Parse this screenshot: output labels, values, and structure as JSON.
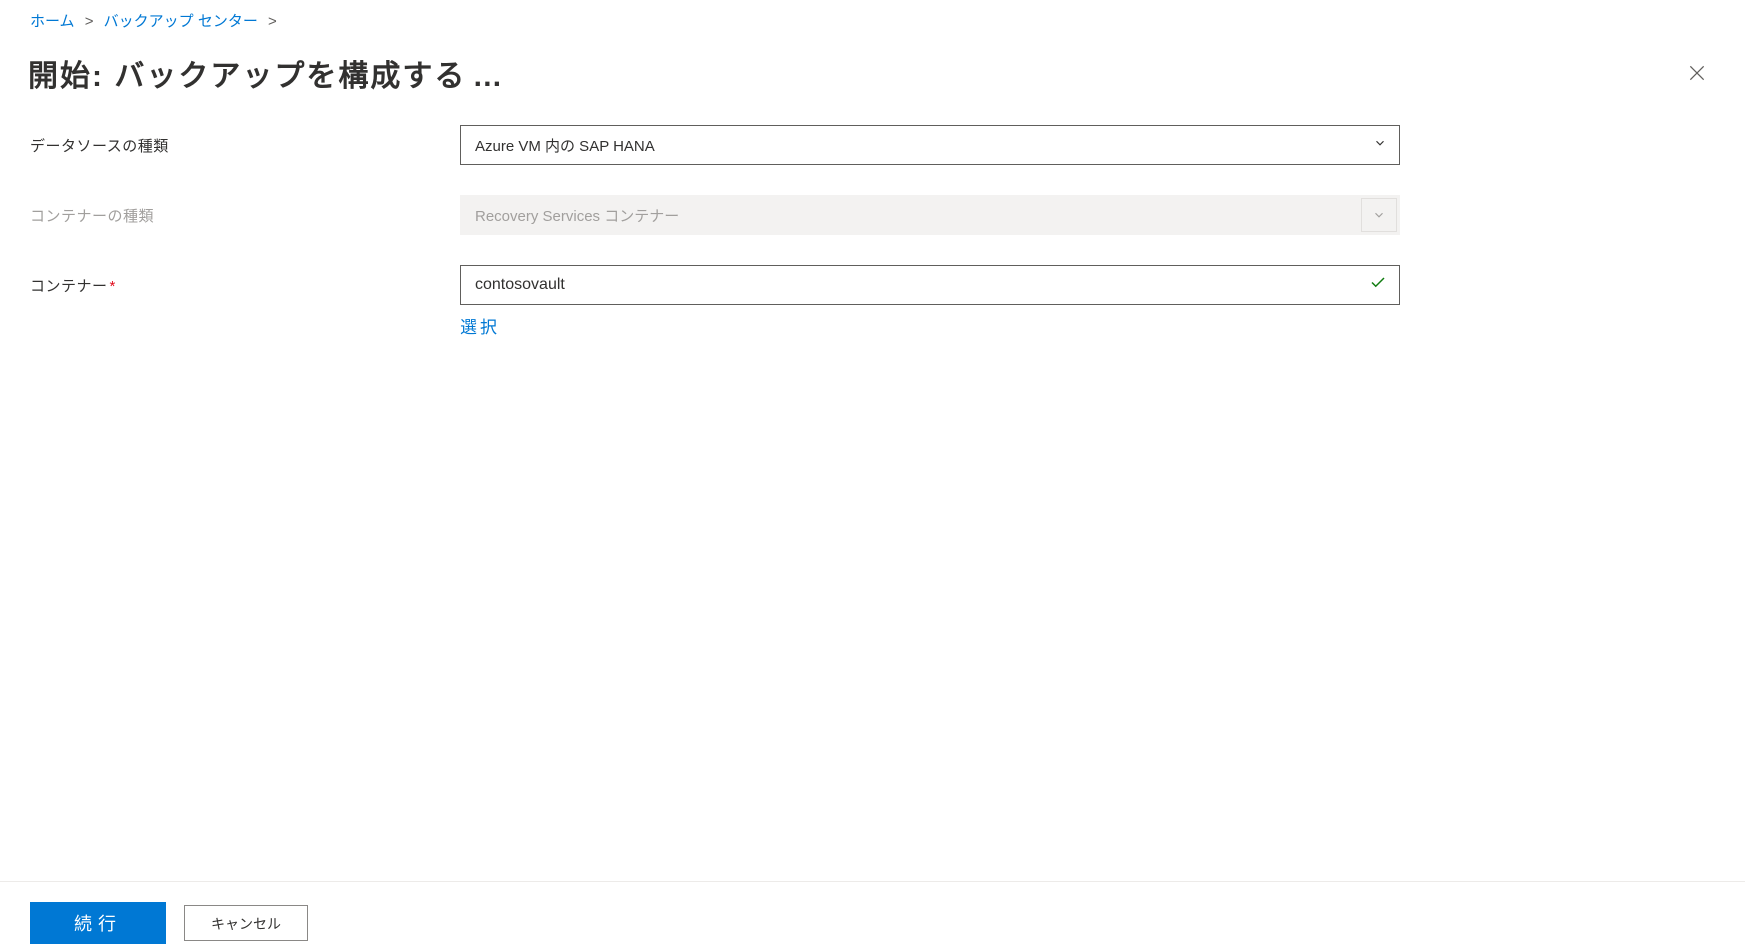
{
  "breadcrumb": {
    "home": "ホーム",
    "backup_center": "バックアップ センター"
  },
  "page_title": "開始: バックアップを構成する",
  "form": {
    "datasource_type": {
      "label": "データソースの種類",
      "value": "Azure VM 内の SAP HANA"
    },
    "container_type": {
      "label": "コンテナーの種類",
      "value": "Recovery Services コンテナー"
    },
    "container": {
      "label": "コンテナー",
      "value": "contosovault",
      "select_link": "選択"
    }
  },
  "footer": {
    "continue": "続行",
    "cancel": "キャンセル"
  }
}
